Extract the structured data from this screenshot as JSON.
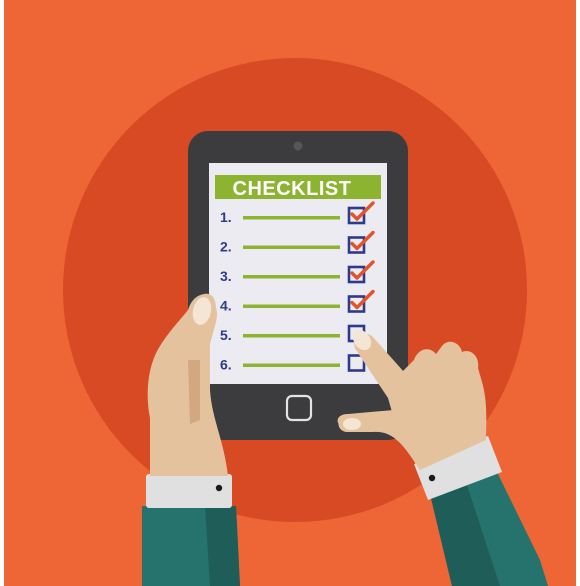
{
  "colors": {
    "background": "#ee6536",
    "circle": "#d84a24",
    "tablet_body": "#3c3c3e",
    "tablet_bezel": "#2d2d2f",
    "screen": "#ecebf2",
    "header_bg": "#8db431",
    "header_text": "#ffffff",
    "number_text": "#2e3a8a",
    "line": "#8db431",
    "checkbox": "#2e3a8a",
    "check": "#e3542a",
    "skin": "#e5c29e",
    "skin_shadow": "#d3a77f",
    "nail": "#f4e5d4",
    "sleeve": "#26726d",
    "sleeve_dark": "#1f5d59",
    "cuff": "#e0e0e0",
    "button": "#e3e3e3"
  },
  "checklist": {
    "title": "CHECKLIST",
    "items": [
      {
        "number": "1.",
        "checked": true
      },
      {
        "number": "2.",
        "checked": true
      },
      {
        "number": "3.",
        "checked": true
      },
      {
        "number": "4.",
        "checked": true
      },
      {
        "number": "5.",
        "checked": false
      },
      {
        "number": "6.",
        "checked": false
      }
    ]
  },
  "icons": {
    "checkbox_checked": "checked-box-icon",
    "checkbox_empty": "empty-box-icon",
    "camera": "camera-icon",
    "home_button": "home-button-icon"
  }
}
